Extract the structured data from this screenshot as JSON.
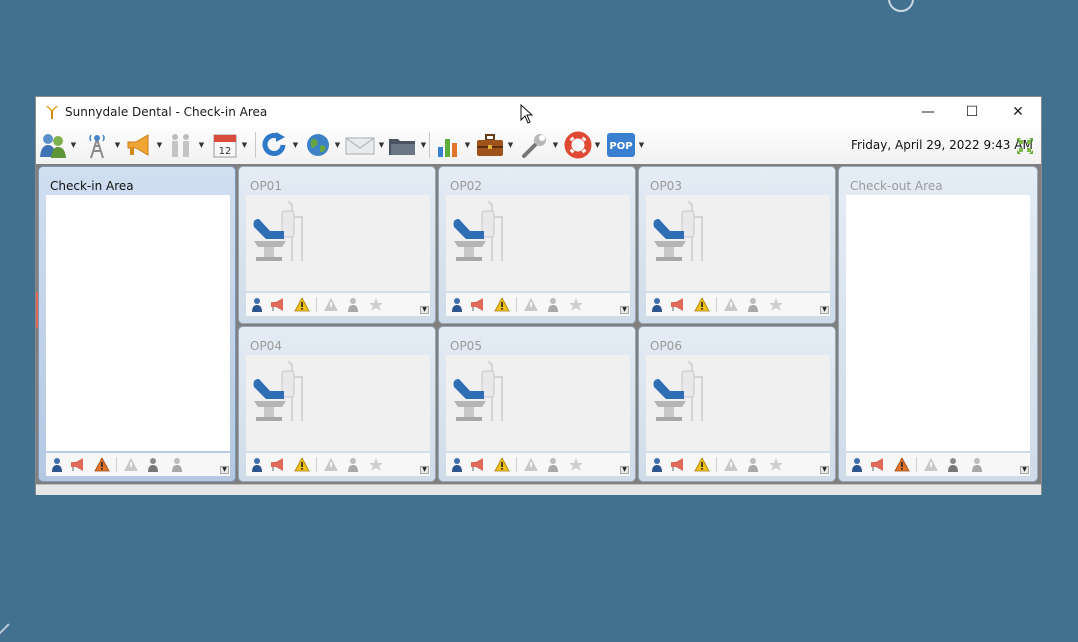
{
  "window": {
    "title": "Sunnydale Dental - Check-in Area",
    "controls": {
      "minimize": "—",
      "maximize": "☐",
      "close": "✕"
    }
  },
  "toolbar": {
    "datetime": "Friday, April 29, 2022 9:43 AM",
    "calendar_day": "12",
    "pop_label": "POP",
    "buttons": [
      "patients-icon",
      "network-tower-icon",
      "megaphone-icon",
      "family-icon",
      "calendar-icon",
      "refresh-icon",
      "globe-icon",
      "mail-icon",
      "folder-icon",
      "bar-chart-icon",
      "briefcase-icon",
      "tools-icon",
      "lifebuoy-icon",
      "pop-icon"
    ]
  },
  "panels": {
    "checkin": {
      "title": "Check-in Area"
    },
    "op01": {
      "title": "OP01"
    },
    "op02": {
      "title": "OP02"
    },
    "op03": {
      "title": "OP03"
    },
    "op04": {
      "title": "OP04"
    },
    "op05": {
      "title": "OP05"
    },
    "op06": {
      "title": "OP06"
    },
    "checkout": {
      "title": "Check-out Area"
    }
  },
  "colors": {
    "desktop": "#41718f",
    "panel_selected": "#b4c8e2",
    "warning": "#f3c21a",
    "alert": "#e0752b",
    "pop_badge": "#3b7fd0"
  }
}
